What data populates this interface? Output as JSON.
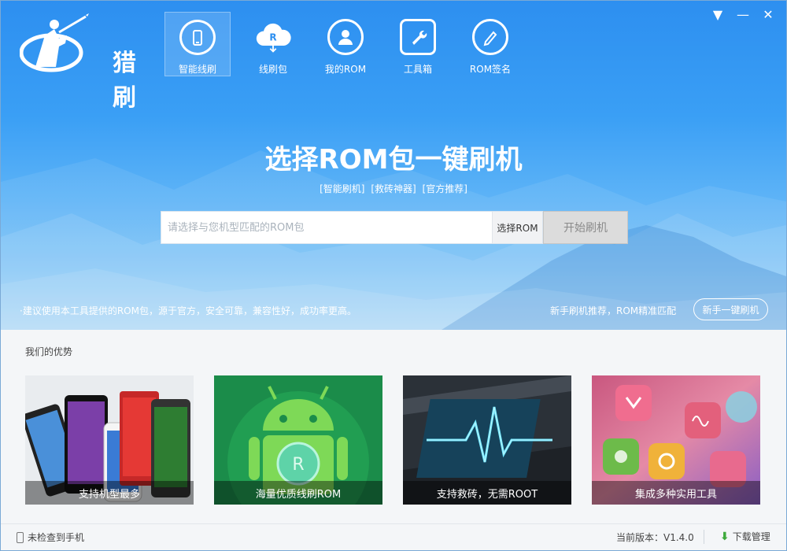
{
  "app": {
    "name": "猎刷"
  },
  "nav": {
    "items": [
      {
        "label": "智能线刷",
        "icon": "phone-refresh-icon",
        "active": true
      },
      {
        "label": "线刷包",
        "icon": "cloud-download-icon",
        "active": false
      },
      {
        "label": "我的ROM",
        "icon": "user-icon",
        "active": false
      },
      {
        "label": "工具箱",
        "icon": "wrench-icon",
        "active": false
      },
      {
        "label": "ROM签名",
        "icon": "pen-icon",
        "active": false
      }
    ]
  },
  "window_controls": {
    "menu": "▼",
    "minimize": "—",
    "close": "✕"
  },
  "hero": {
    "title": "选择ROM包一键刷机",
    "tags": [
      "[智能刷机]",
      "[救砖神器]",
      "[官方推荐]"
    ],
    "search": {
      "placeholder": "请选择与您机型匹配的ROM包",
      "value": ""
    },
    "select_rom": "选择ROM",
    "start_button": "开始刷机",
    "note": "·建议使用本工具提供的ROM包，源于官方，安全可靠，兼容性好，成功率更高。",
    "recommend": "新手刷机推荐，ROM精准匹配",
    "newbie_button": "新手一键刷机"
  },
  "advantages": {
    "title": "我们的优势",
    "cards": [
      {
        "caption": "支持机型最多",
        "icon": "phones-icon"
      },
      {
        "caption": "海量优质线刷ROM",
        "icon": "android-icon"
      },
      {
        "caption": "支持救砖，无需ROOT",
        "icon": "pulse-icon"
      },
      {
        "caption": "集成多种实用工具",
        "icon": "apps-icon"
      }
    ]
  },
  "status": {
    "phone": "未检查到手机",
    "version": "当前版本：V1.4.0",
    "download_manager": "下载管理"
  },
  "colors": {
    "accent": "#2d8ff0",
    "download": "#3eaa3c"
  }
}
